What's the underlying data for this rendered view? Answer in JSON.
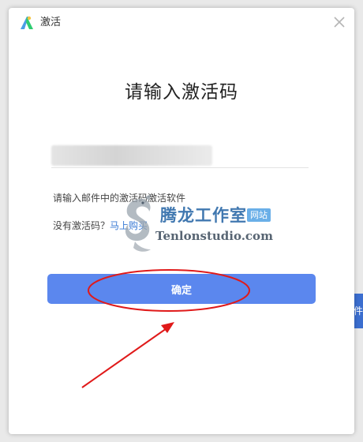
{
  "window": {
    "title": "激活",
    "close_icon": "close-icon",
    "logo_icon": "app-logo-icon"
  },
  "heading": "请输入激活码",
  "activation_code": {
    "value": "",
    "placeholder": ""
  },
  "hint": "请输入邮件中的激活码激活软件",
  "no_code": {
    "label": "没有激活码？",
    "buy_link": "马上购买"
  },
  "confirm_button": "确定",
  "side_tab": "件",
  "watermark": {
    "name": "腾龙工作室",
    "badge": "网站",
    "domain": "Tenlonstudio.com"
  },
  "colors": {
    "accent": "#5b87ee",
    "link": "#3a7bd5",
    "annotation": "#e01a1a"
  }
}
